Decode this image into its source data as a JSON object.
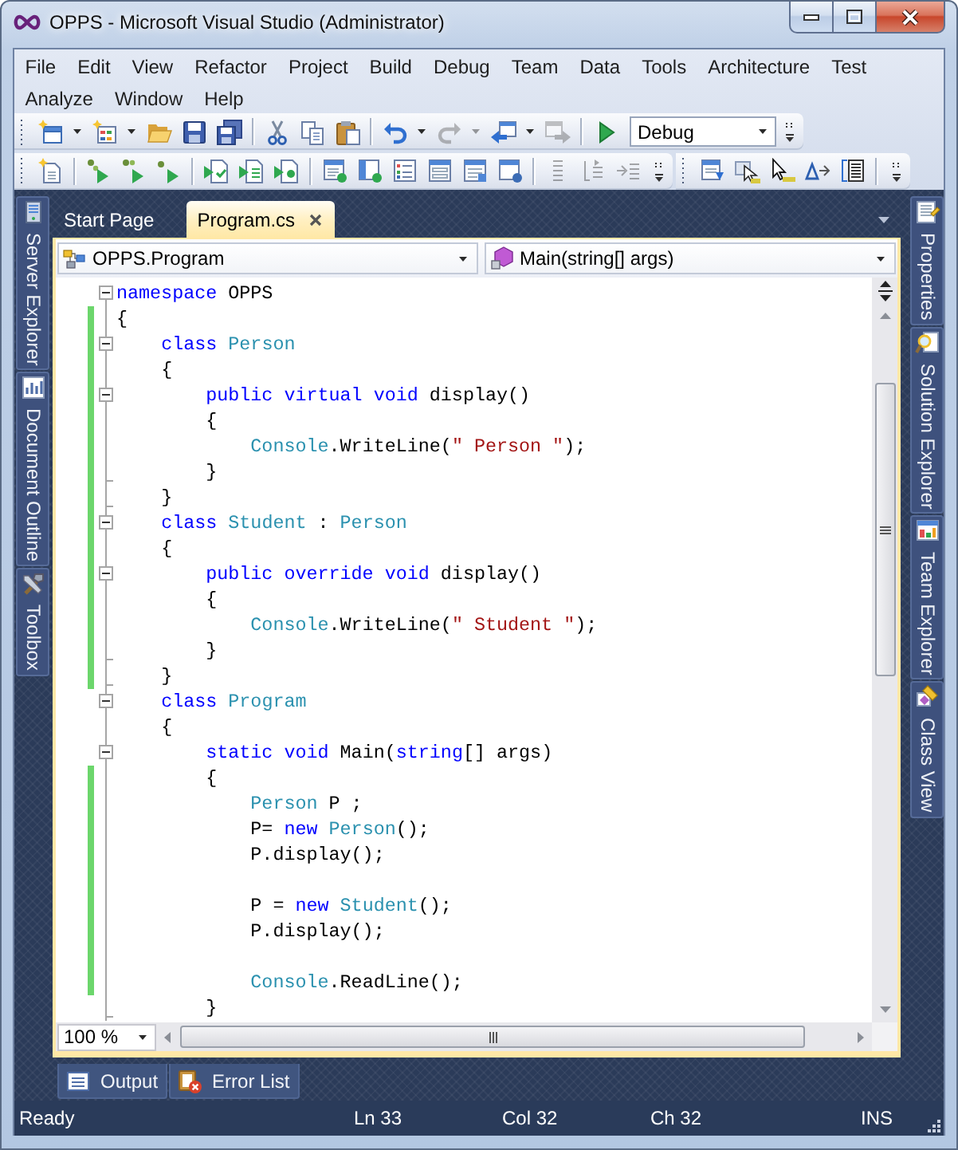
{
  "window": {
    "title": "OPPS - Microsoft Visual Studio (Administrator)"
  },
  "menu": [
    {
      "label": "File"
    },
    {
      "label": "Edit"
    },
    {
      "label": "View"
    },
    {
      "label": "Refactor"
    },
    {
      "label": "Project"
    },
    {
      "label": "Build"
    },
    {
      "label": "Debug"
    },
    {
      "label": "Team"
    },
    {
      "label": "Data"
    },
    {
      "label": "Tools"
    },
    {
      "label": "Architecture"
    },
    {
      "label": "Test"
    },
    {
      "label": "Analyze"
    },
    {
      "label": "Window"
    },
    {
      "label": "Help"
    }
  ],
  "toolbar_rows": [
    {
      "toolbars": [
        {
          "items": [
            {
              "kind": "split",
              "disabled": false
            },
            {
              "kind": "split",
              "disabled": false
            },
            {
              "kind": "button",
              "disabled": false
            },
            {
              "kind": "button",
              "disabled": false
            },
            {
              "kind": "button",
              "disabled": false
            },
            {
              "kind": "separator"
            },
            {
              "kind": "button",
              "disabled": false
            },
            {
              "kind": "button",
              "disabled": false
            },
            {
              "kind": "button",
              "disabled": false
            },
            {
              "kind": "separator"
            },
            {
              "kind": "split",
              "disabled": false
            },
            {
              "kind": "split",
              "disabled": true
            },
            {
              "kind": "split",
              "disabled": false
            },
            {
              "kind": "button",
              "disabled": true
            },
            {
              "kind": "separator"
            },
            {
              "kind": "button",
              "disabled": false
            },
            {
              "kind": "combo",
              "value": "Debug"
            },
            {
              "kind": "overflow"
            }
          ]
        }
      ]
    },
    {
      "toolbars": [
        {
          "items": [
            {
              "kind": "button",
              "disabled": false
            },
            {
              "kind": "separator"
            },
            {
              "kind": "button",
              "disabled": false
            },
            {
              "kind": "button",
              "disabled": false
            },
            {
              "kind": "button",
              "disabled": false
            },
            {
              "kind": "separator"
            },
            {
              "kind": "button",
              "disabled": false
            },
            {
              "kind": "button",
              "disabled": false
            },
            {
              "kind": "button",
              "disabled": false
            },
            {
              "kind": "separator"
            },
            {
              "kind": "button",
              "disabled": false
            },
            {
              "kind": "button",
              "disabled": false
            },
            {
              "kind": "button",
              "disabled": false
            },
            {
              "kind": "button",
              "disabled": false
            },
            {
              "kind": "button",
              "disabled": false
            },
            {
              "kind": "button",
              "disabled": false
            },
            {
              "kind": "separator"
            },
            {
              "kind": "button",
              "disabled": true
            },
            {
              "kind": "button",
              "disabled": true
            },
            {
              "kind": "button",
              "disabled": true
            },
            {
              "kind": "overflow"
            }
          ]
        },
        {
          "items": [
            {
              "kind": "button",
              "disabled": false
            },
            {
              "kind": "button",
              "disabled": false
            },
            {
              "kind": "button",
              "disabled": false
            },
            {
              "kind": "button",
              "disabled": false
            },
            {
              "kind": "button",
              "disabled": false
            },
            {
              "kind": "separator"
            },
            {
              "kind": "overflow"
            }
          ]
        }
      ]
    }
  ],
  "side_tabs": {
    "left": [
      {
        "label": "Server Explorer"
      },
      {
        "label": "Document Outline"
      },
      {
        "label": "Toolbox"
      }
    ],
    "right": [
      {
        "label": "Properties"
      },
      {
        "label": "Solution Explorer"
      },
      {
        "label": "Team Explorer"
      },
      {
        "label": "Class View"
      }
    ]
  },
  "document_tabs": [
    {
      "label": "Start Page",
      "selected": false
    },
    {
      "label": "Program.cs",
      "selected": true
    }
  ],
  "navigation": {
    "type": "OPPS.Program",
    "member": "Main(string[] args)"
  },
  "editor": {
    "lines": [
      {
        "kind": "block",
        "expanded": true,
        "tokens": [
          {
            "kind": "keyword",
            "text": "namespace"
          },
          {
            "kind": "plain",
            "text": " OPPS"
          }
        ],
        "changed": false
      },
      {
        "kind": "line",
        "tokens": [
          {
            "kind": "plain",
            "text": "{"
          }
        ],
        "changed": true
      },
      {
        "kind": "block",
        "expanded": true,
        "tokens": [
          {
            "kind": "keyword",
            "text": "    class"
          },
          {
            "kind": "type",
            "text": " Person"
          }
        ],
        "changed": true
      },
      {
        "kind": "line",
        "tokens": [
          {
            "kind": "plain",
            "text": "    {"
          }
        ],
        "changed": true
      },
      {
        "kind": "block",
        "expanded": true,
        "tokens": [
          {
            "kind": "keyword",
            "text": "        public"
          },
          {
            "kind": "keyword",
            "text": " virtual"
          },
          {
            "kind": "keyword",
            "text": " void"
          },
          {
            "kind": "plain",
            "text": " display()"
          }
        ],
        "changed": true
      },
      {
        "kind": "line",
        "tokens": [
          {
            "kind": "plain",
            "text": "        {"
          }
        ],
        "changed": true
      },
      {
        "kind": "line",
        "tokens": [
          {
            "kind": "type",
            "text": "            Console"
          },
          {
            "kind": "plain",
            "text": ".WriteLine("
          },
          {
            "kind": "string",
            "text": "\" Person \""
          },
          {
            "kind": "plain",
            "text": ");"
          }
        ],
        "changed": true
      },
      {
        "kind": "blockend",
        "tokens": [
          {
            "kind": "plain",
            "text": "        }"
          }
        ],
        "changed": true
      },
      {
        "kind": "blockend",
        "tokens": [
          {
            "kind": "plain",
            "text": "    }"
          }
        ],
        "changed": true
      },
      {
        "kind": "block",
        "expanded": true,
        "tokens": [
          {
            "kind": "keyword",
            "text": "    class"
          },
          {
            "kind": "type",
            "text": " Student"
          },
          {
            "kind": "plain",
            "text": " :"
          },
          {
            "kind": "type",
            "text": " Person"
          }
        ],
        "changed": true
      },
      {
        "kind": "line",
        "tokens": [
          {
            "kind": "plain",
            "text": "    {"
          }
        ],
        "changed": true
      },
      {
        "kind": "block",
        "expanded": true,
        "tokens": [
          {
            "kind": "keyword",
            "text": "        public"
          },
          {
            "kind": "keyword",
            "text": " override"
          },
          {
            "kind": "keyword",
            "text": " void"
          },
          {
            "kind": "plain",
            "text": " display()"
          }
        ],
        "changed": true
      },
      {
        "kind": "line",
        "tokens": [
          {
            "kind": "plain",
            "text": "        {"
          }
        ],
        "changed": true
      },
      {
        "kind": "line",
        "tokens": [
          {
            "kind": "type",
            "text": "            Console"
          },
          {
            "kind": "plain",
            "text": ".WriteLine("
          },
          {
            "kind": "string",
            "text": "\" Student \""
          },
          {
            "kind": "plain",
            "text": ");"
          }
        ],
        "changed": true
      },
      {
        "kind": "blockend",
        "tokens": [
          {
            "kind": "plain",
            "text": "        }"
          }
        ],
        "changed": true
      },
      {
        "kind": "blockend",
        "tokens": [
          {
            "kind": "plain",
            "text": "    }"
          }
        ],
        "changed": true
      },
      {
        "kind": "block",
        "expanded": true,
        "tokens": [
          {
            "kind": "keyword",
            "text": "    class"
          },
          {
            "kind": "type",
            "text": " Program"
          }
        ],
        "changed": false
      },
      {
        "kind": "line",
        "tokens": [
          {
            "kind": "plain",
            "text": "    {"
          }
        ],
        "changed": false
      },
      {
        "kind": "block",
        "expanded": true,
        "tokens": [
          {
            "kind": "keyword",
            "text": "        static"
          },
          {
            "kind": "keyword",
            "text": " void"
          },
          {
            "kind": "plain",
            "text": " Main("
          },
          {
            "kind": "keyword",
            "text": "string"
          },
          {
            "kind": "plain",
            "text": "[] args)"
          }
        ],
        "changed": false
      },
      {
        "kind": "line",
        "tokens": [
          {
            "kind": "plain",
            "text": "        {"
          }
        ],
        "changed": true
      },
      {
        "kind": "line",
        "tokens": [
          {
            "kind": "type",
            "text": "            Person"
          },
          {
            "kind": "plain",
            "text": " P ;"
          }
        ],
        "changed": true
      },
      {
        "kind": "line",
        "tokens": [
          {
            "kind": "plain",
            "text": "            P="
          },
          {
            "kind": "keyword",
            "text": " new"
          },
          {
            "kind": "type",
            "text": " Person"
          },
          {
            "kind": "plain",
            "text": "();"
          }
        ],
        "changed": true
      },
      {
        "kind": "line",
        "tokens": [
          {
            "kind": "plain",
            "text": "            P.display();"
          }
        ],
        "changed": true
      },
      {
        "kind": "line",
        "changed": true
      },
      {
        "kind": "line",
        "tokens": [
          {
            "kind": "plain",
            "text": "            P ="
          },
          {
            "kind": "keyword",
            "text": " new"
          },
          {
            "kind": "type",
            "text": " Student"
          },
          {
            "kind": "plain",
            "text": "();"
          }
        ],
        "changed": true
      },
      {
        "kind": "line",
        "tokens": [
          {
            "kind": "plain",
            "text": "            P.display();"
          }
        ],
        "changed": true
      },
      {
        "kind": "line",
        "changed": true
      },
      {
        "kind": "line",
        "tokens": [
          {
            "kind": "type",
            "text": "            Console"
          },
          {
            "kind": "plain",
            "text": ".ReadLine();"
          }
        ],
        "changed": true
      },
      {
        "kind": "blockend",
        "tokens": [
          {
            "kind": "plain",
            "text": "        }"
          }
        ],
        "changed": false
      }
    ],
    "zoom": "100 %"
  },
  "tool_tabs": [
    {
      "label": "Output"
    },
    {
      "label": "Error List"
    }
  ],
  "status_bar": {
    "message": "Ready",
    "line": "Ln 33",
    "column": "Col 32",
    "character": "Ch 32",
    "mode": "INS"
  }
}
